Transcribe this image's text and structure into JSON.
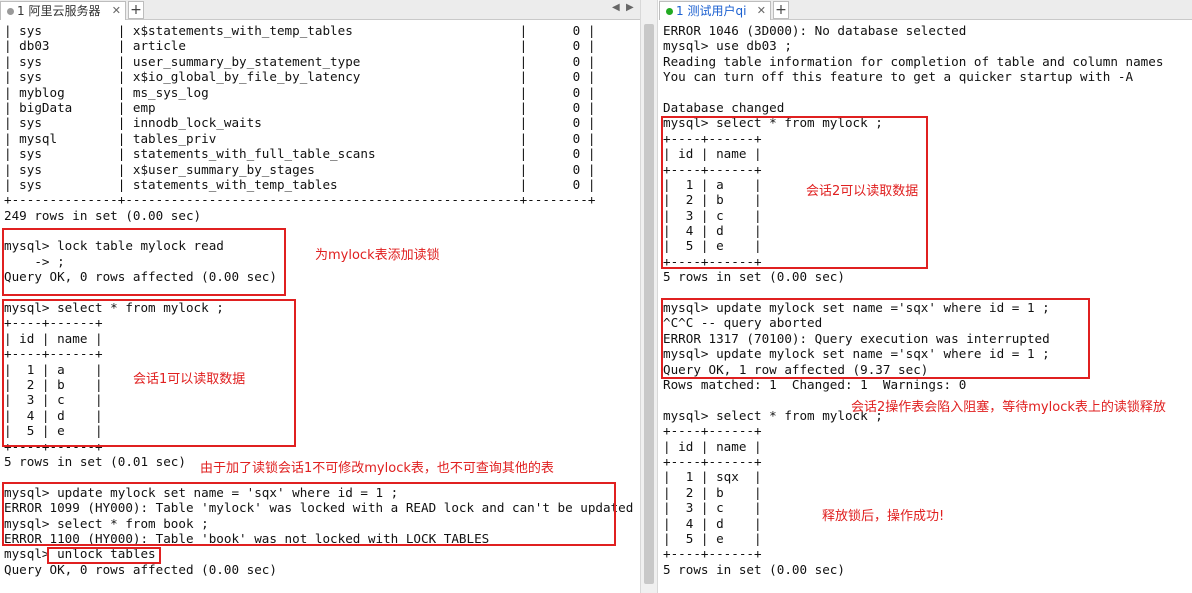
{
  "left": {
    "tab_label": "1 阿里云服务器",
    "terminal_lines": [
      "| sys          | x$statements_with_temp_tables                      |      0 |",
      "| db03         | article                                            |      0 |",
      "| sys          | user_summary_by_statement_type                     |      0 |",
      "| sys          | x$io_global_by_file_by_latency                     |      0 |",
      "| myblog       | ms_sys_log                                         |      0 |",
      "| bigData      | emp                                                |      0 |",
      "| sys          | innodb_lock_waits                                  |      0 |",
      "| mysql        | tables_priv                                        |      0 |",
      "| sys          | statements_with_full_table_scans                   |      0 |",
      "| sys          | x$user_summary_by_stages                           |      0 |",
      "| sys          | statements_with_temp_tables                        |      0 |",
      "+--------------+----------------------------------------------------+--------+",
      "249 rows in set (0.00 sec)",
      "",
      "mysql> lock table mylock read",
      "    -> ;",
      "Query OK, 0 rows affected (0.00 sec)",
      "",
      "mysql> select * from mylock ;",
      "+----+------+",
      "| id | name |",
      "+----+------+",
      "|  1 | a    |",
      "|  2 | b    |",
      "|  3 | c    |",
      "|  4 | d    |",
      "|  5 | e    |",
      "+----+------+",
      "5 rows in set (0.01 sec)",
      "",
      "mysql> update mylock set name = 'sqx' where id = 1 ;",
      "ERROR 1099 (HY000): Table 'mylock' was locked with a READ lock and can't be updated",
      "mysql> select * from book ;",
      "ERROR 1100 (HY000): Table 'book' was not locked with LOCK TABLES",
      "mysql> unlock tables",
      "Query OK, 0 rows affected (0.00 sec)"
    ],
    "annotations": {
      "lock_read": "为mylock表添加读锁",
      "session1_read": "会话1可以读取数据",
      "cannot_modify": "由于加了读锁会话1不可修改mylock表，也不可查询其他的表"
    }
  },
  "right": {
    "tab_label": "1 测试用户qi",
    "terminal_lines": [
      "ERROR 1046 (3D000): No database selected",
      "mysql> use db03 ;",
      "Reading table information for completion of table and column names",
      "You can turn off this feature to get a quicker startup with -A",
      "",
      "Database changed",
      "mysql> select * from mylock ;",
      "+----+------+",
      "| id | name |",
      "+----+------+",
      "|  1 | a    |",
      "|  2 | b    |",
      "|  3 | c    |",
      "|  4 | d    |",
      "|  5 | e    |",
      "+----+------+",
      "5 rows in set (0.00 sec)",
      "",
      "mysql> update mylock set name ='sqx' where id = 1 ;",
      "^C^C -- query aborted",
      "ERROR 1317 (70100): Query execution was interrupted",
      "mysql> update mylock set name ='sqx' where id = 1 ;",
      "Query OK, 1 row affected (9.37 sec)",
      "Rows matched: 1  Changed: 1  Warnings: 0",
      "",
      "mysql> select * from mylock ;",
      "+----+------+",
      "| id | name |",
      "+----+------+",
      "|  1 | sqx  |",
      "|  2 | b    |",
      "|  3 | c    |",
      "|  4 | d    |",
      "|  5 | e    |",
      "+----+------+",
      "5 rows in set (0.00 sec)"
    ],
    "annotations": {
      "session2_read": "会话2可以读取数据",
      "session2_blocked": "会话2操作表会陷入阻塞，等待mylock表上的读锁释放",
      "success": "释放锁后，操作成功!"
    }
  },
  "tab_icons": {
    "left": "gray-status-dot",
    "right": "green-status-dot",
    "close": "close-icon",
    "add": "plus-icon"
  },
  "colors": {
    "annotation": "#e02020",
    "left_dot": "#9a9a9a",
    "right_dot": "#22aa22",
    "right_tab_text": "#1a5fd0"
  }
}
